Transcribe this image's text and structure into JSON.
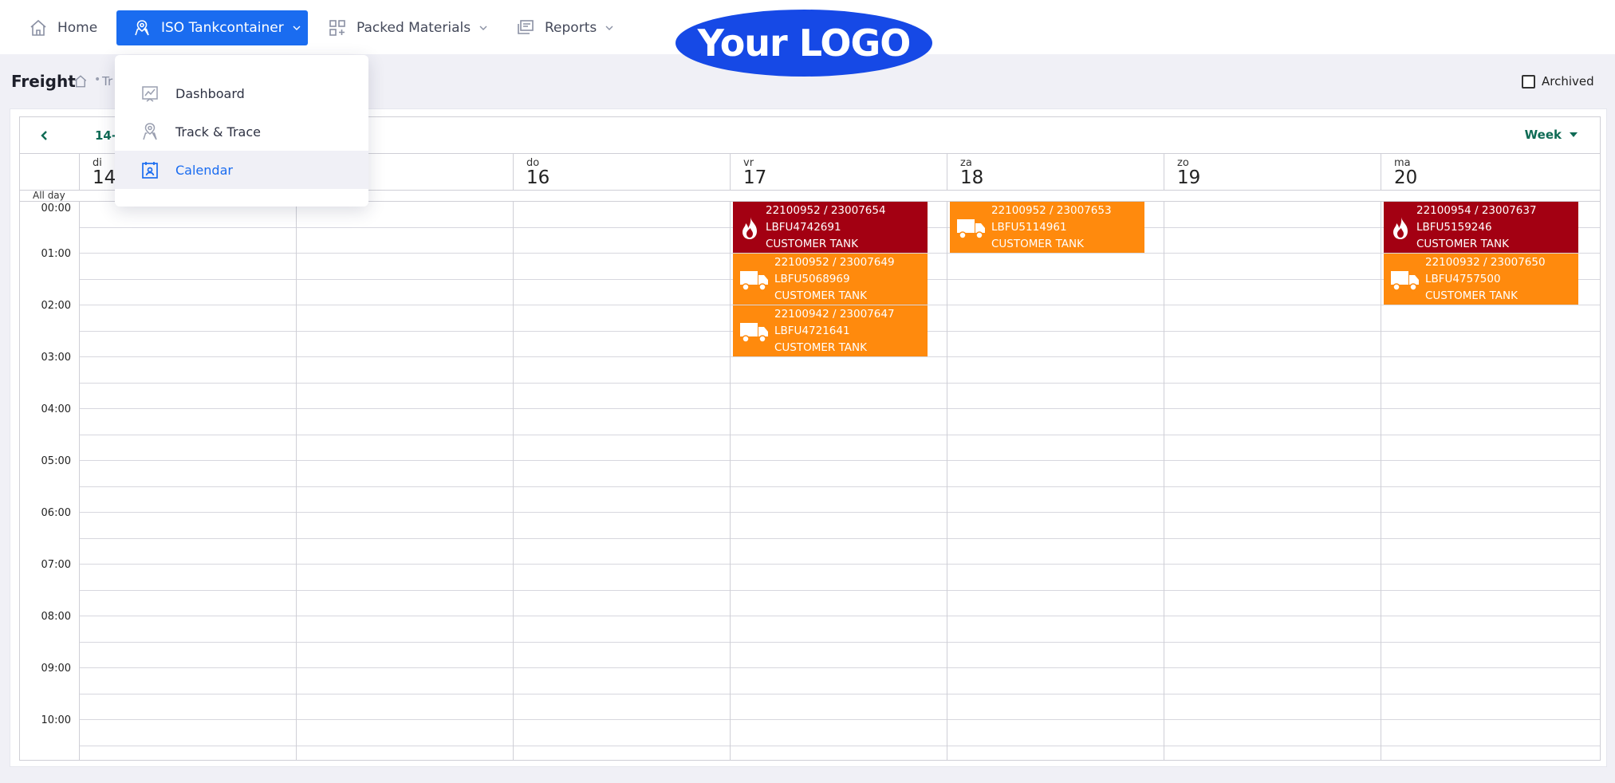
{
  "nav": {
    "home_label": "Home",
    "iso_label": "ISO Tankcontainer",
    "packed_label": "Packed Materials",
    "reports_label": "Reports",
    "logo_text": "Your LOGO",
    "accent_color": "#1a6cf0"
  },
  "dropdown": {
    "items": [
      {
        "label": "Dashboard",
        "icon": "chart-icon"
      },
      {
        "label": "Track & Trace",
        "icon": "location-pin-icon"
      },
      {
        "label": "Calendar",
        "icon": "calendar-icon",
        "active": true
      }
    ]
  },
  "page": {
    "title": "Freight",
    "breadcrumb_sep": "•",
    "breadcrumb_text": "Tr",
    "archived_label": "Archived"
  },
  "calendar": {
    "range_label": "14-",
    "view_label": "Week",
    "allday_label": "All day",
    "days": [
      {
        "dow": "di",
        "num": "14"
      },
      {
        "dow": "",
        "num": ""
      },
      {
        "dow": "do",
        "num": "16"
      },
      {
        "dow": "vr",
        "num": "17"
      },
      {
        "dow": "za",
        "num": "18"
      },
      {
        "dow": "zo",
        "num": "19"
      },
      {
        "dow": "ma",
        "num": "20"
      }
    ],
    "times": [
      "00:00",
      "01:00",
      "02:00",
      "03:00",
      "04:00",
      "05:00",
      "06:00",
      "07:00",
      "08:00",
      "09:00",
      "10:00"
    ],
    "event_colors": {
      "hazard": "#a30012",
      "transport": "#ff8a0d"
    },
    "events": [
      {
        "day": "vr 17",
        "ref": "22100952 / 23007654",
        "container": "LBFU4742691",
        "type": "CUSTOMER TANK",
        "icon": "flame-icon",
        "color": "#a30012"
      },
      {
        "day": "vr 17",
        "ref": "22100952 / 23007649",
        "container": "LBFU5068969",
        "type": "CUSTOMER TANK",
        "icon": "truck-icon",
        "color": "#ff8a0d"
      },
      {
        "day": "vr 17",
        "ref": "22100942 / 23007647",
        "container": "LBFU4721641",
        "type": "CUSTOMER TANK",
        "icon": "truck-icon",
        "color": "#ff8a0d"
      },
      {
        "day": "za 18",
        "ref": "22100952 / 23007653",
        "container": "LBFU5114961",
        "type": "CUSTOMER TANK",
        "icon": "truck-icon",
        "color": "#ff8a0d"
      },
      {
        "day": "ma 20",
        "ref": "22100954 / 23007637",
        "container": "LBFU5159246",
        "type": "CUSTOMER TANK",
        "icon": "flame-icon",
        "color": "#a30012"
      },
      {
        "day": "ma 20",
        "ref": "22100932 / 23007650",
        "container": "LBFU4757500",
        "type": "CUSTOMER TANK",
        "icon": "truck-icon",
        "color": "#ff8a0d"
      }
    ]
  }
}
